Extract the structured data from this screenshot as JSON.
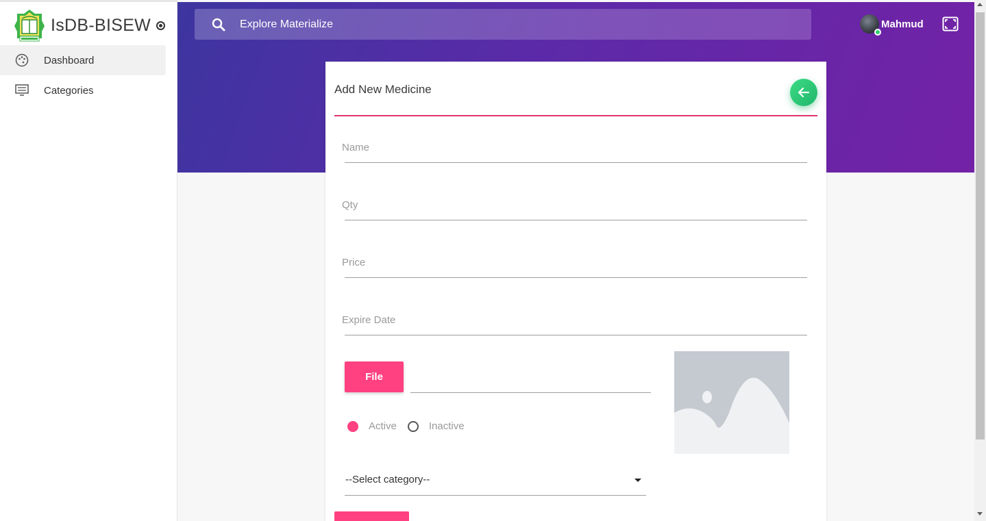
{
  "sidebar": {
    "brand": "IsDB-BISEW",
    "items": [
      {
        "label": "Dashboard",
        "icon": "palette-icon"
      },
      {
        "label": "Categories",
        "icon": "list-icon"
      }
    ]
  },
  "header": {
    "search_placeholder": "Explore Materialize",
    "user_name": "Mahmud"
  },
  "form": {
    "title": "Add New Medicine",
    "fields": {
      "name_label": "Name",
      "qty_label": "Qty",
      "price_label": "Price",
      "expire_label": "Expire Date"
    },
    "file_button": "File",
    "status_options": [
      "Active",
      "Inactive"
    ],
    "selected_status": "Active",
    "category_selected": "--Select category--"
  },
  "colors": {
    "accent_pink": "#ff4081",
    "underline": "#e0336f",
    "gradient_start": "#3d35a0",
    "gradient_end": "#7322a6",
    "back_button": "#1fb56b"
  }
}
